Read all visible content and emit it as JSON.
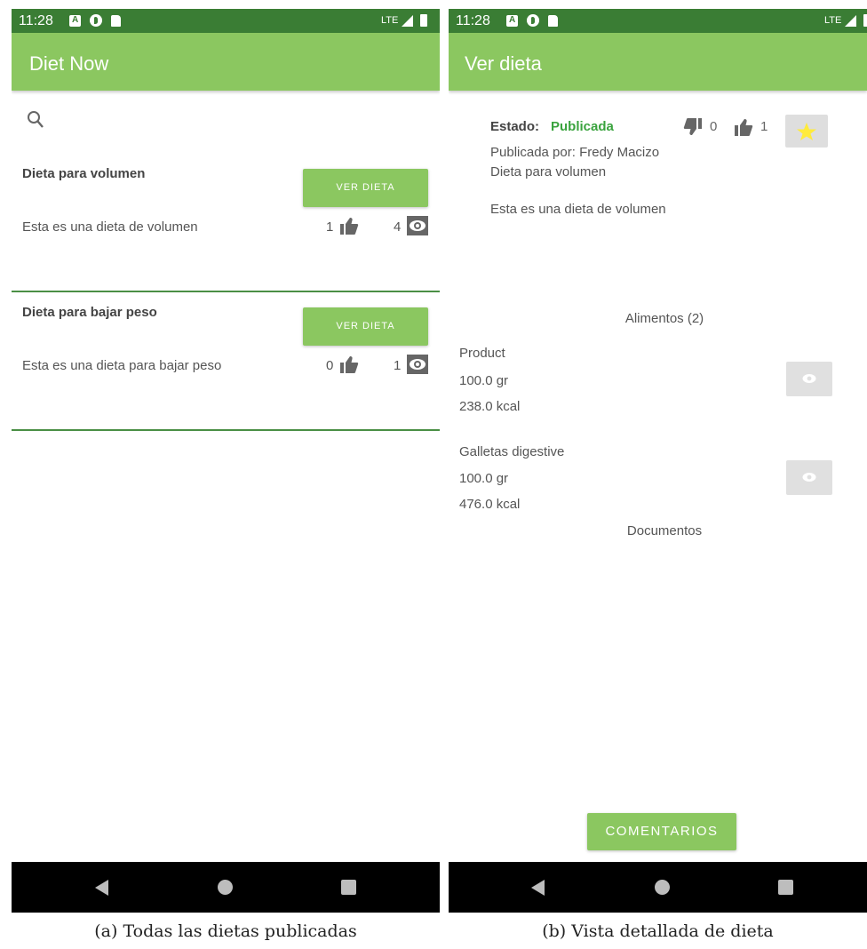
{
  "status_bar": {
    "time": "11:28",
    "network": "LTE"
  },
  "list_screen": {
    "title": "Diet Now",
    "diets": [
      {
        "name": "Dieta para volumen",
        "description": "Esta es una dieta de volumen",
        "button": "VER DIETA",
        "likes": "1",
        "views": "4"
      },
      {
        "name": "Dieta para bajar peso",
        "description": "Esta es una dieta para bajar peso",
        "button": "VER DIETA",
        "likes": "0",
        "views": "1"
      }
    ],
    "caption": "(a) Todas las dietas publicadas"
  },
  "detail_screen": {
    "title": "Ver dieta",
    "estado_label": "Estado:",
    "estado_value": "Publicada",
    "dislikes": "0",
    "likes": "1",
    "published_by": "Publicada por: Fredy Macizo",
    "name": "Dieta para volumen",
    "description": "Esta es una dieta de volumen",
    "foods_title": "Alimentos (2)",
    "foods": [
      {
        "name": "Product",
        "amount": "100.0 gr",
        "kcal": "238.0 kcal"
      },
      {
        "name": "Galletas digestive",
        "amount": "100.0 gr",
        "kcal": "476.0 kcal"
      }
    ],
    "documents_title": "Documentos",
    "comments_button": "COMENTARIOS",
    "caption": "(b) Vista detallada de dieta"
  },
  "colors": {
    "status_bar": "#3a7d34",
    "app_bar": "#8bc760",
    "accent_green": "#3aa33e",
    "star": "#ffeb3b"
  }
}
